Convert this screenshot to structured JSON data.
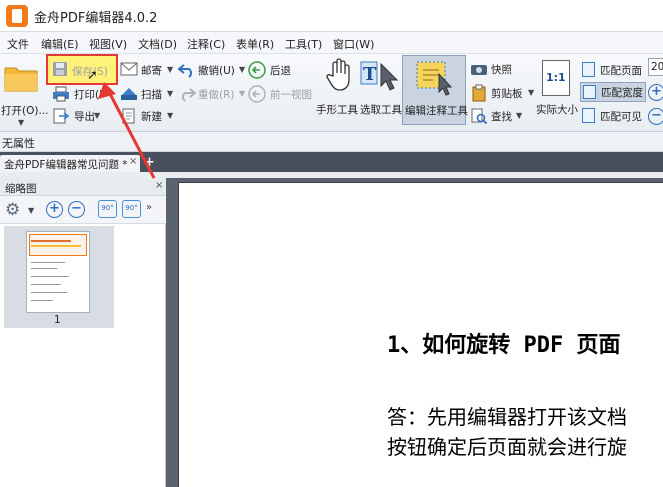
{
  "app": {
    "title": "金舟PDF编辑器4.0.2"
  },
  "menu": [
    "文件",
    "编辑(E)",
    "视图(V)",
    "文档(D)",
    "注释(C)",
    "表单(R)",
    "工具(T)",
    "窗口(W)"
  ],
  "toolbar": {
    "open": "打开(O)...",
    "save": "保存(S)",
    "print": "打印(P",
    "export": "导出",
    "mail": "邮寄",
    "scan": "扫描",
    "new": "新建",
    "undo": "撤销(U)",
    "redo": "重做(R)",
    "back": "后退",
    "prev_view": "前一视图",
    "hand_tool": "手形工具",
    "select_tool": "选取工具",
    "edit_annot_tool": "编辑注释工具",
    "snapshot": "快照",
    "clipboard": "剪贴板",
    "find": "查找",
    "actual_size": "实际大小",
    "actual_size_icon_text": "1:1",
    "fit_page": "匹配页面",
    "fit_width": "匹配宽度",
    "fit_visible": "匹配可见",
    "zoom_value": "20"
  },
  "properties_bar": {
    "label": "无属性"
  },
  "tabs": [
    {
      "label": "金舟PDF编辑器常见问题 *"
    }
  ],
  "thumbnails": {
    "title": "缩略图",
    "rotate_left_label": "90°",
    "rotate_right_label": "90°",
    "pages": [
      {
        "number": "1"
      }
    ]
  },
  "document": {
    "heading": "1、如何旋转 PDF 页面",
    "paragraph_lines": [
      "答：先用编辑器打开该文档",
      "按钮确定后页面就会进行旋"
    ]
  },
  "colors": {
    "accent": "#2f6fbf",
    "highlight_red": "#e53935",
    "save_yellow": "#fff27a",
    "brand_orange": "#f27a1a"
  }
}
